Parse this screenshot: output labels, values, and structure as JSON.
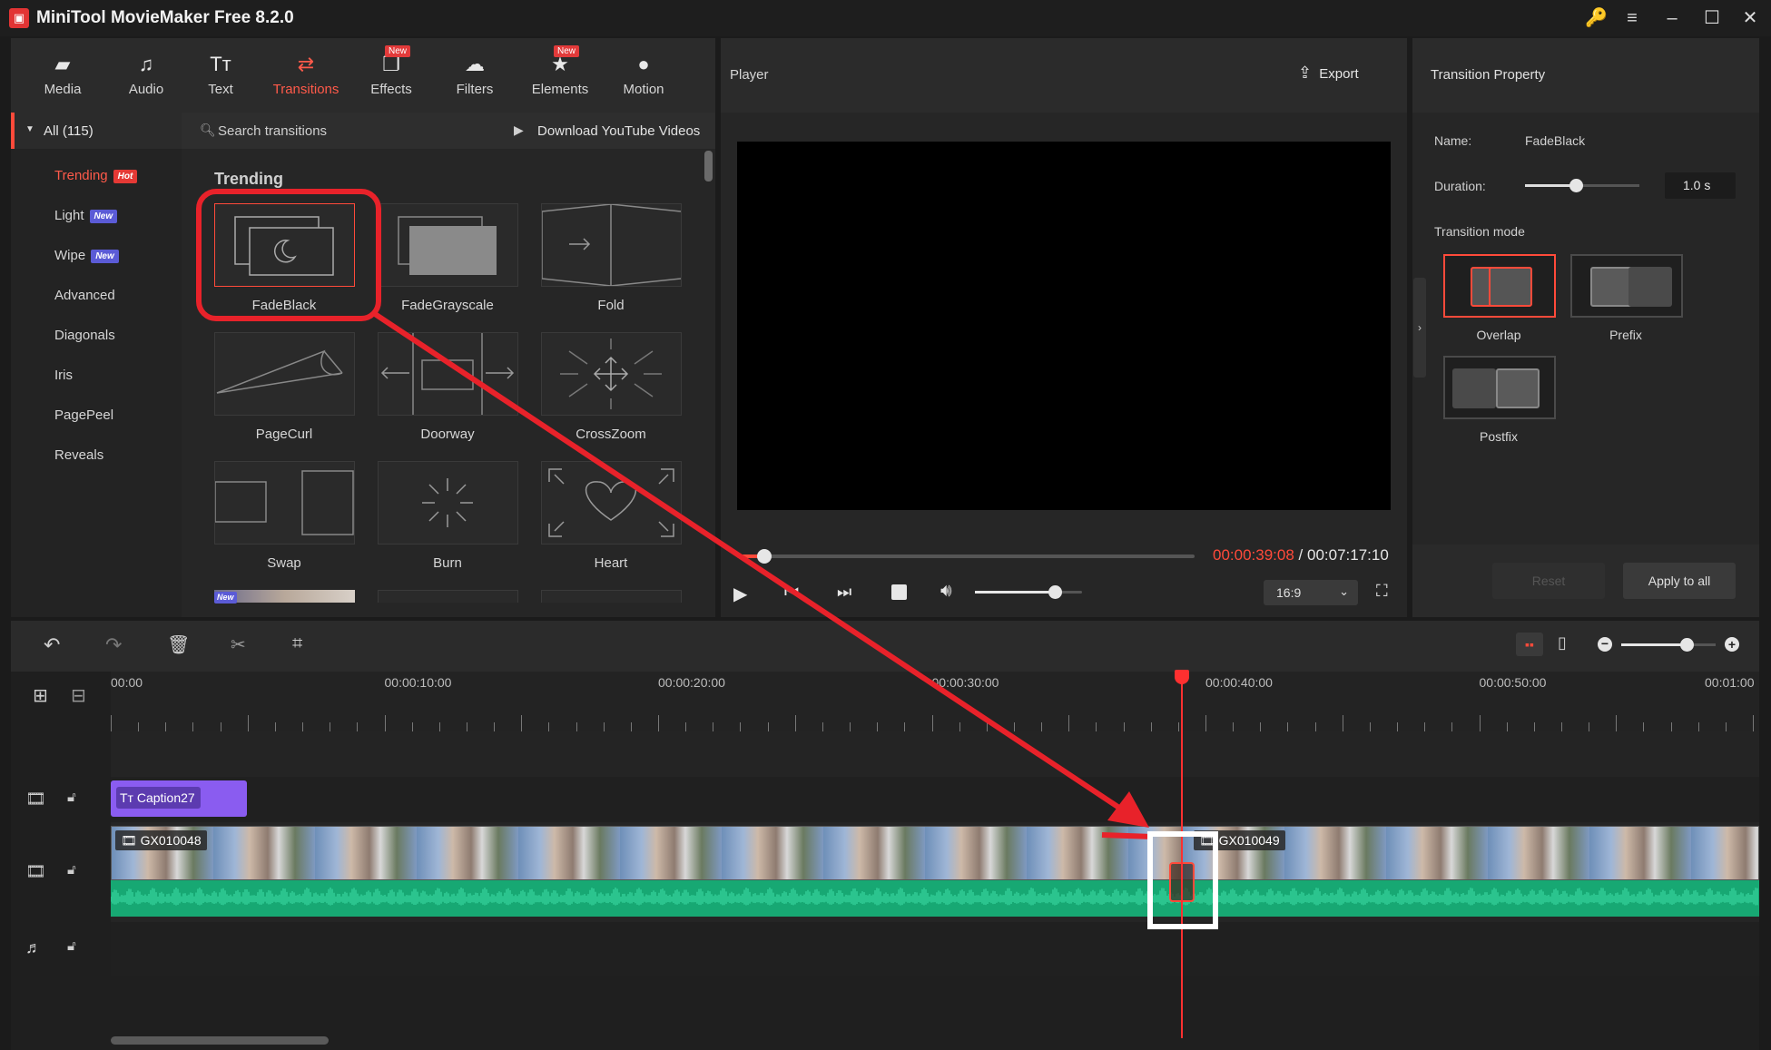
{
  "app": {
    "title": "MiniTool MovieMaker Free 8.2.0"
  },
  "toolbar": {
    "items": [
      {
        "label": "Media",
        "icon": "folder-icon"
      },
      {
        "label": "Audio",
        "icon": "music-note-icon"
      },
      {
        "label": "Text",
        "icon": "text-icon"
      },
      {
        "label": "Transitions",
        "icon": "transition-arrows-icon",
        "active": true
      },
      {
        "label": "Effects",
        "icon": "effects-icon",
        "badge": "New"
      },
      {
        "label": "Filters",
        "icon": "filters-icon"
      },
      {
        "label": "Elements",
        "icon": "elements-icon",
        "badge": "New"
      },
      {
        "label": "Motion",
        "icon": "motion-icon"
      }
    ]
  },
  "categories": {
    "all": "All (115)",
    "items": [
      {
        "label": "Trending",
        "badge": "Hot"
      },
      {
        "label": "Light",
        "badge": "New"
      },
      {
        "label": "Wipe",
        "badge": "New"
      },
      {
        "label": "Advanced"
      },
      {
        "label": "Diagonals"
      },
      {
        "label": "Iris"
      },
      {
        "label": "PagePeel"
      },
      {
        "label": "Reveals"
      }
    ]
  },
  "library": {
    "search_placeholder": "Search transitions",
    "download_label": "Download YouTube Videos",
    "section": "Trending",
    "transitions": [
      "FadeBlack",
      "FadeGrayscale",
      "Fold",
      "PageCurl",
      "Doorway",
      "CrossZoom",
      "Swap",
      "Burn",
      "Heart"
    ],
    "partial_badge": "New"
  },
  "player": {
    "title": "Player",
    "export_label": "Export",
    "current_time": "00:00:39:08",
    "separator": " / ",
    "total_time": "00:07:17:10",
    "progress": 0.06,
    "volume": 0.75,
    "aspect": "16:9"
  },
  "property": {
    "title": "Transition Property",
    "name_label": "Name:",
    "name_value": "FadeBlack",
    "duration_label": "Duration:",
    "duration_value": "1.0 s",
    "duration_level": 0.45,
    "mode_label": "Transition mode",
    "modes": [
      "Overlap",
      "Prefix",
      "Postfix"
    ],
    "reset_label": "Reset",
    "apply_label": "Apply to all"
  },
  "timeline": {
    "ruler_labels": [
      "00:00",
      "00:00:10:00",
      "00:00:20:00",
      "00:00:30:00",
      "00:00:40:00",
      "00:00:50:00",
      "00:01:00"
    ],
    "caption_clip": "Caption27",
    "clip_a": "GX010048",
    "clip_b": "GX010049",
    "zoom_level": 0.7
  },
  "colors": {
    "accent": "#ff4a3a",
    "caption": "#8a5cf0",
    "audio": "#1fbf85",
    "annotation": "#e8222a"
  }
}
